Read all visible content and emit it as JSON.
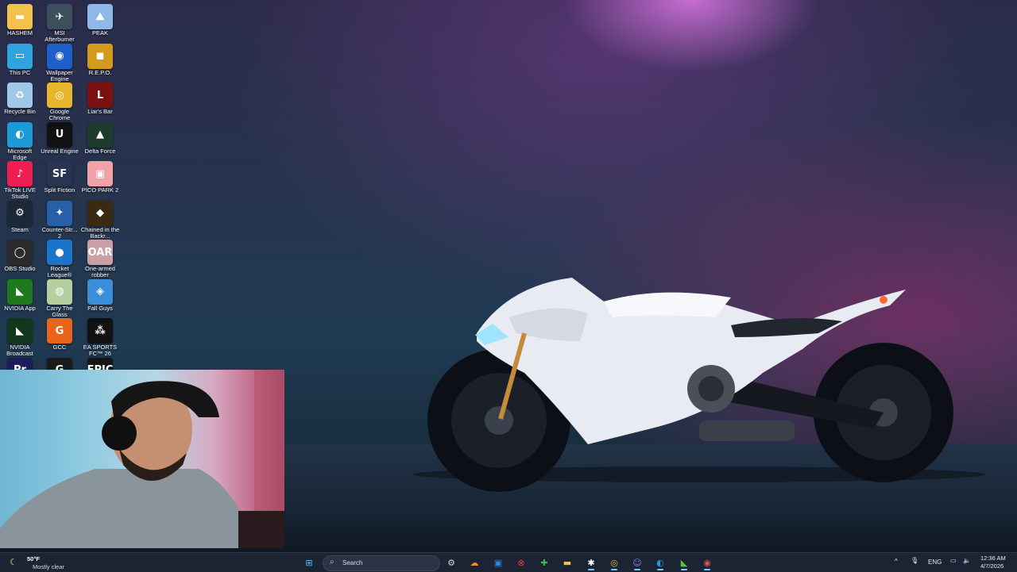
{
  "desktop": {
    "icons": [
      {
        "label": "HASHEM",
        "icon": "folder-icon",
        "color": "#f2c14e"
      },
      {
        "label": "MSI Afterburner",
        "icon": "msi-afterburner-icon",
        "color": "#3b4f5c"
      },
      {
        "label": "PEAK",
        "icon": "peak-icon",
        "color": "#8fb8e8"
      },
      {
        "label": "This PC",
        "icon": "monitor-icon",
        "color": "#2fa3e0"
      },
      {
        "label": "Wallpaper Engine",
        "icon": "wallpaper-engine-icon",
        "color": "#1e5fc9"
      },
      {
        "label": "R.E.P.O.",
        "icon": "repo-icon",
        "color": "#d49a1c"
      },
      {
        "label": "Recycle Bin",
        "icon": "recycle-bin-icon",
        "color": "#9fc7e8"
      },
      {
        "label": "Google Chrome",
        "icon": "chrome-icon",
        "color": "#e8b62c"
      },
      {
        "label": "Liar's Bar",
        "icon": "liars-bar-icon",
        "color": "#7a1010"
      },
      {
        "label": "Microsoft Edge",
        "icon": "edge-icon",
        "color": "#1b9ad6"
      },
      {
        "label": "Unreal Engine",
        "icon": "unreal-engine-icon",
        "color": "#111111"
      },
      {
        "label": "Delta Force",
        "icon": "delta-force-icon",
        "color": "#1d3b2c"
      },
      {
        "label": "TikTok LIVE Studio",
        "icon": "tiktok-icon",
        "color": "#ee1d52"
      },
      {
        "label": "Split Fiction",
        "icon": "split-fiction-icon",
        "color": "#2a3350"
      },
      {
        "label": "PICO PARK 2",
        "icon": "pico-park-icon",
        "color": "#f1a1a8"
      },
      {
        "label": "Steam",
        "icon": "steam-icon",
        "color": "#1b2838"
      },
      {
        "label": "Counter-Str... 2",
        "icon": "counter-strike-icon",
        "color": "#2760a8"
      },
      {
        "label": "Chained in the Backr...",
        "icon": "chained-icon",
        "color": "#3b2a12"
      },
      {
        "label": "OBS Studio",
        "icon": "obs-icon",
        "color": "#2b2b2b"
      },
      {
        "label": "Rocket League®",
        "icon": "rocket-league-icon",
        "color": "#1a74c9"
      },
      {
        "label": "One-armed robber",
        "icon": "one-armed-robber-icon",
        "color": "#c9a0a8"
      },
      {
        "label": "NVIDIA App",
        "icon": "nvidia-icon",
        "color": "#1f7a1f"
      },
      {
        "label": "Carry The Glass",
        "icon": "carry-the-glass-icon",
        "color": "#b6cfa0"
      },
      {
        "label": "Fall Guys",
        "icon": "fall-guys-icon",
        "color": "#3a8fd8"
      },
      {
        "label": "NVIDIA Broadcast",
        "icon": "nvidia-broadcast-icon",
        "color": "#14361c"
      },
      {
        "label": "GCC",
        "icon": "gcc-icon",
        "color": "#e8641a"
      },
      {
        "label": "EA SPORTS FC™ 26",
        "icon": "ea-sports-fc-icon",
        "color": "#111111"
      },
      {
        "label": "",
        "icon": "premiere-pro-icon",
        "color": "#1d1d5a"
      },
      {
        "label": "",
        "icon": "g-hub-icon",
        "color": "#1a1a1a"
      },
      {
        "label": "",
        "icon": "epic-games-icon",
        "color": "#151515"
      }
    ],
    "glyphs": [
      "▬",
      "✈",
      "⛰",
      "▭",
      "◉",
      "◼",
      "♻",
      "◎",
      "L",
      "◐",
      "U",
      "▲",
      "♪",
      "SF",
      "▣",
      "⚙",
      "✦",
      "◆",
      "◯",
      "●",
      "OAR",
      "◣",
      "◍",
      "◈",
      "◣",
      "G",
      "⁂",
      "Pr",
      "G",
      "EPIC"
    ]
  },
  "taskbar": {
    "weather": {
      "temp": "50°F",
      "condition": "Mostly clear"
    },
    "search_placeholder": "Search",
    "apps": [
      {
        "icon": "windows-start-icon",
        "glyph": "⊞",
        "color": "#4cc2ff"
      },
      {
        "icon": "widgets-icon",
        "glyph": "✿",
        "color": "#ffb0d0"
      },
      {
        "icon": "settings-icon",
        "glyph": "⚙",
        "color": "#cfd6e2"
      },
      {
        "icon": "cloud-app-icon",
        "glyph": "☁",
        "color": "#f28b2b"
      },
      {
        "icon": "image-viewer-icon",
        "glyph": "▣",
        "color": "#2b8ad8"
      },
      {
        "icon": "red-app-icon",
        "glyph": "⊗",
        "color": "#e23b3b"
      },
      {
        "icon": "green-app-icon",
        "glyph": "✚",
        "color": "#3bb84f"
      },
      {
        "icon": "file-explorer-icon",
        "glyph": "▬",
        "color": "#f2c14e"
      },
      {
        "icon": "steelseries-icon",
        "glyph": "✱",
        "color": "#ffffff"
      },
      {
        "icon": "chrome-icon",
        "glyph": "◎",
        "color": "#e8b62c"
      },
      {
        "icon": "discord-icon",
        "glyph": "☺",
        "color": "#7c8cf2"
      },
      {
        "icon": "edge-icon",
        "glyph": "◐",
        "color": "#1b9ad6"
      },
      {
        "icon": "nvidia-broadcast-icon",
        "glyph": "◣",
        "color": "#58c436"
      },
      {
        "icon": "obs-icon",
        "glyph": "◉",
        "color": "#e05050"
      }
    ],
    "tray": {
      "chevron": "^",
      "language": "ENG",
      "time": "12:36 AM",
      "date": "4/7/2026"
    }
  }
}
